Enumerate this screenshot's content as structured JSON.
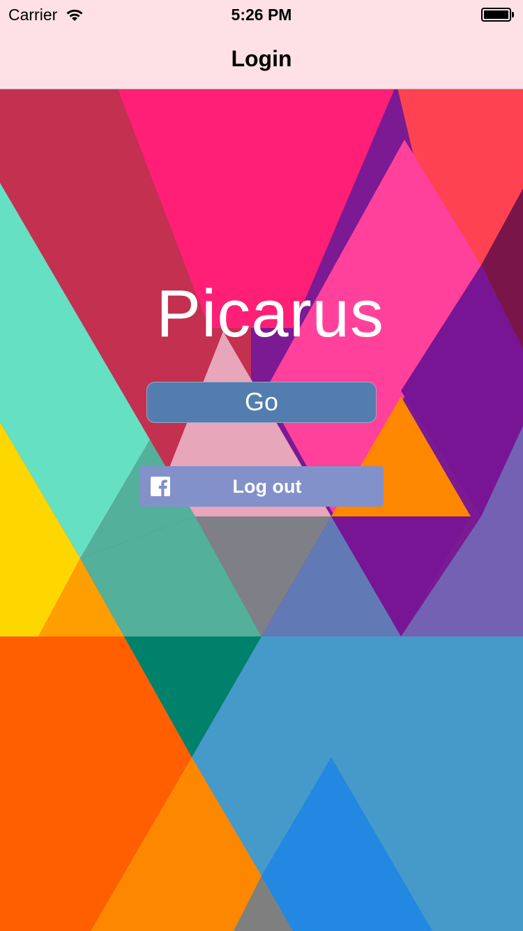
{
  "status_bar": {
    "carrier": "Carrier",
    "time": "5:26 PM",
    "wifi_icon": "wifi-icon",
    "battery_icon": "battery-full-icon"
  },
  "nav_bar": {
    "title": "Login"
  },
  "app": {
    "title": "Picarus",
    "go_label": "Go",
    "facebook_button": {
      "label": "Log out",
      "icon": "facebook-icon"
    }
  },
  "colors": {
    "nav_background": "#fde1e6",
    "go_button": "#527dae",
    "facebook_button": "#8391ca",
    "text_light": "#ffffff"
  }
}
